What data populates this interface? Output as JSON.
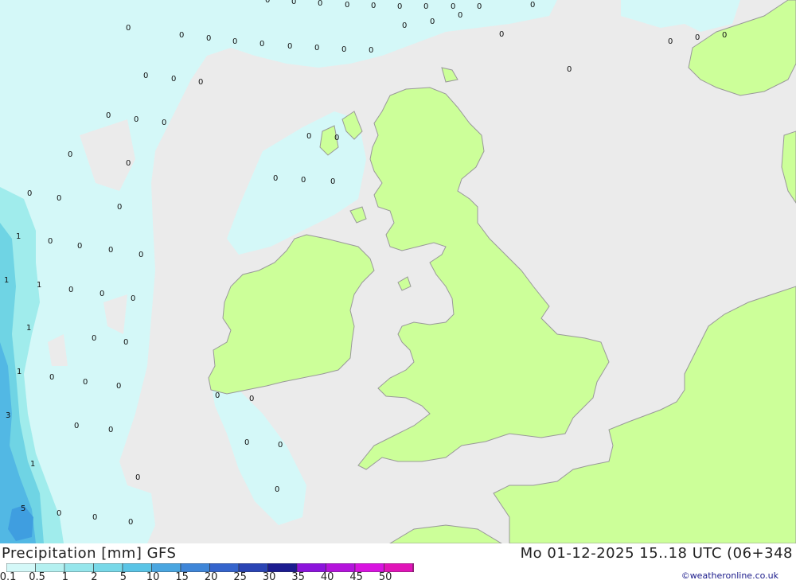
{
  "title": "Precipitation [mm] GFS",
  "datetime": "Mo 01-12-2025 15..18 UTC (06+348",
  "credit": "©weatheronline.co.uk",
  "colors": {
    "sea": "#ebebeb",
    "land": "#ccff99",
    "coast": "#999999",
    "precip_light": "#d4f8f8",
    "precip_medium": "#a0ecec",
    "precip_heavy": "#6fd4e4",
    "precip_heaviest": "#52b8e4"
  },
  "legend": {
    "labels": [
      "0.1",
      "0.5",
      "1",
      "2",
      "5",
      "10",
      "15",
      "20",
      "25",
      "30",
      "35",
      "40",
      "45",
      "50"
    ],
    "colors": [
      "#d4f8f8",
      "#b4f0f0",
      "#96e6ec",
      "#78d8e8",
      "#5ac4e6",
      "#4aa6e0",
      "#3f86d8",
      "#3564cc",
      "#2a44b4",
      "#1c1c90",
      "#8c14dc",
      "#b414dc",
      "#d814e0",
      "#e014b8",
      "#c0149a"
    ]
  },
  "precip_values": [
    "0",
    "0",
    "0",
    "0",
    "0",
    "0",
    "0",
    "0",
    "0",
    "0",
    "0",
    "0",
    "0",
    "0",
    "0",
    "0",
    "0",
    "0",
    "0",
    "0",
    "0",
    "0",
    "0",
    "0",
    "0",
    "0",
    "0",
    "0",
    "0",
    "0",
    "0",
    "0",
    "0",
    "0",
    "0",
    "0",
    "0",
    "0",
    "0",
    "0",
    "0",
    "0",
    "0",
    "0",
    "0",
    "0",
    "0",
    "0",
    "0",
    "0",
    "0",
    "0",
    "0",
    "0",
    "0",
    "0",
    "0",
    "0",
    "0",
    "0",
    "0",
    "0",
    "0",
    "0",
    "0",
    "0",
    "1",
    "1",
    "1",
    "1",
    "1",
    "3",
    "1",
    "5"
  ]
}
